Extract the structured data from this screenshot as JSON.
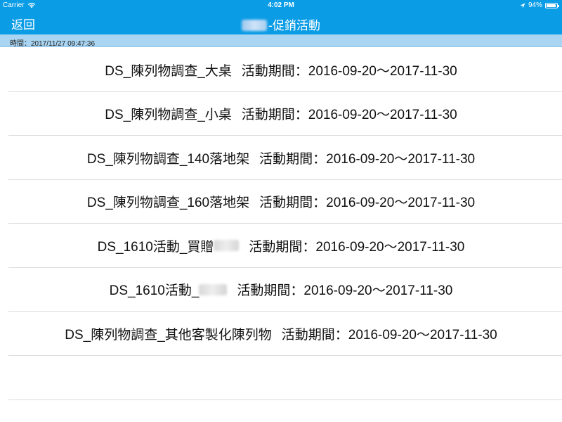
{
  "status_bar": {
    "carrier": "Carrier",
    "time": "4:02 PM",
    "battery": "94%",
    "battery_level": 0.94
  },
  "nav": {
    "back_label": "返回",
    "title_suffix": "-促銷活動"
  },
  "time_bar": {
    "text": "時間：2017/11/27 09:47:36"
  },
  "items": [
    {
      "name": "DS_陳列物調查_大桌",
      "period": "活動期間：2016-09-20～2017-11-30"
    },
    {
      "name": "DS_陳列物調查_小桌",
      "period": "活動期間：2016-09-20～2017-11-30"
    },
    {
      "name": "DS_陳列物調查_140落地架",
      "period": "活動期間：2016-09-20～2017-11-30"
    },
    {
      "name": "DS_陳列物調查_160落地架",
      "period": "活動期間：2016-09-20～2017-11-30"
    },
    {
      "name": "DS_1610活動_買贈",
      "period": "活動期間：2016-09-20～2017-11-30"
    },
    {
      "name": "DS_1610活動_",
      "period": "活動期間：2016-09-20～2017-11-30"
    },
    {
      "name": "DS_陳列物調查_其他客製化陳列物",
      "period": "活動期間：2016-09-20～2017-11-30"
    }
  ]
}
